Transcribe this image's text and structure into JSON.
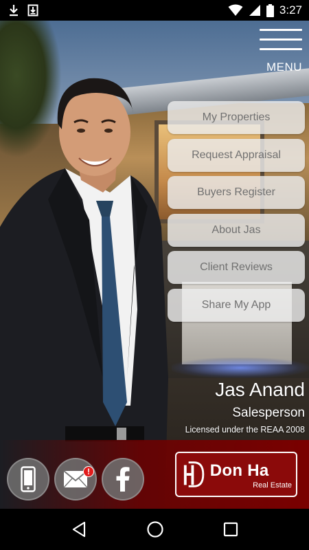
{
  "status_bar": {
    "time": "3:27",
    "icons": [
      "download-icon",
      "download-box-icon",
      "wifi-icon",
      "signal-icon",
      "battery-icon"
    ]
  },
  "menu": {
    "label": "MENU",
    "items": [
      {
        "label": "My Properties"
      },
      {
        "label": "Request Appraisal"
      },
      {
        "label": "Buyers Register"
      },
      {
        "label": "About Jas"
      },
      {
        "label": "Client Reviews"
      },
      {
        "label": "Share My App"
      }
    ]
  },
  "agent": {
    "name": "Jas Anand",
    "role": "Salesperson",
    "license": "Licensed under the REAA 2008"
  },
  "contact": {
    "buttons": [
      "phone-icon",
      "email-icon",
      "facebook-icon"
    ],
    "email_badge": "!"
  },
  "logo": {
    "main": "Don Ha",
    "sub": "Real Estate"
  },
  "colors": {
    "brand_red": "#8b0a0a",
    "menu_item_bg": "#ececec",
    "menu_text": "#707070",
    "badge_red": "#e21b1b"
  }
}
